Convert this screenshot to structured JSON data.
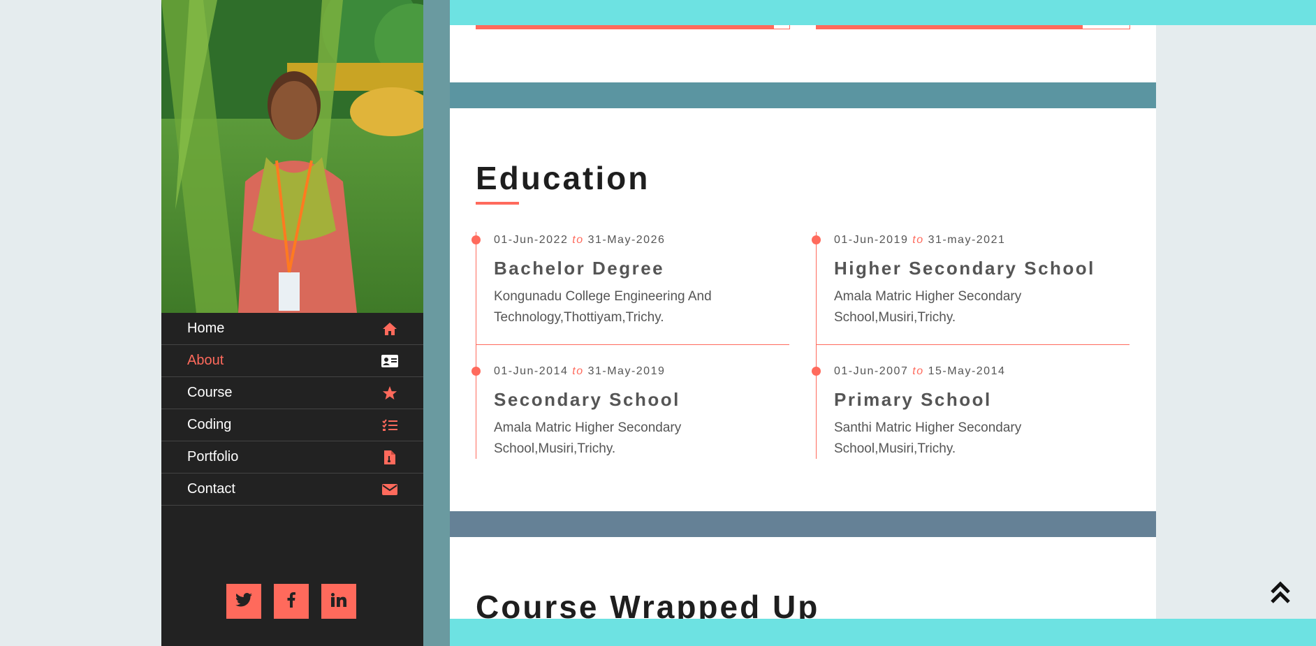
{
  "sidebar": {
    "nav": [
      {
        "label": "Home",
        "icon": "home-icon",
        "active": false
      },
      {
        "label": "About",
        "icon": "id-card-icon",
        "active": true
      },
      {
        "label": "Course",
        "icon": "star-icon",
        "active": false
      },
      {
        "label": "Coding",
        "icon": "list-check-icon",
        "active": false
      },
      {
        "label": "Portfolio",
        "icon": "file-icon",
        "active": false
      },
      {
        "label": "Contact",
        "icon": "envelope-icon",
        "active": false
      }
    ],
    "social": [
      "twitter-icon",
      "facebook-icon",
      "linkedin-icon"
    ]
  },
  "skills": [
    {
      "progress": 0.95
    },
    {
      "progress": 0.85
    }
  ],
  "education": {
    "title": "Education",
    "to_label": "to",
    "items": [
      {
        "start": "01-Jun-2022",
        "end": "31-May-2026",
        "degree": "Bachelor Degree",
        "school": "Kongunadu College Engineering And Technology,Thottiyam,Trichy."
      },
      {
        "start": "01-Jun-2019",
        "end": "31-may-2021",
        "degree": "Higher Secondary School",
        "school": "Amala Matric Higher Secondary School,Musiri,Trichy."
      },
      {
        "start": "01-Jun-2014",
        "end": "31-May-2019",
        "degree": "Secondary School",
        "school": "Amala Matric Higher Secondary School,Musiri,Trichy."
      },
      {
        "start": "01-Jun-2007",
        "end": "15-May-2014",
        "degree": "Primary School",
        "school": "Santhi Matric Higher Secondary School,Musiri,Trichy."
      }
    ]
  },
  "next_section": {
    "title": "Course Wrapped Up"
  },
  "colors": {
    "accent": "#ff6a5c",
    "topbar": "#6de2e2",
    "sidebar": "#222222",
    "band1": "#5b95a1",
    "band2": "#658196"
  }
}
